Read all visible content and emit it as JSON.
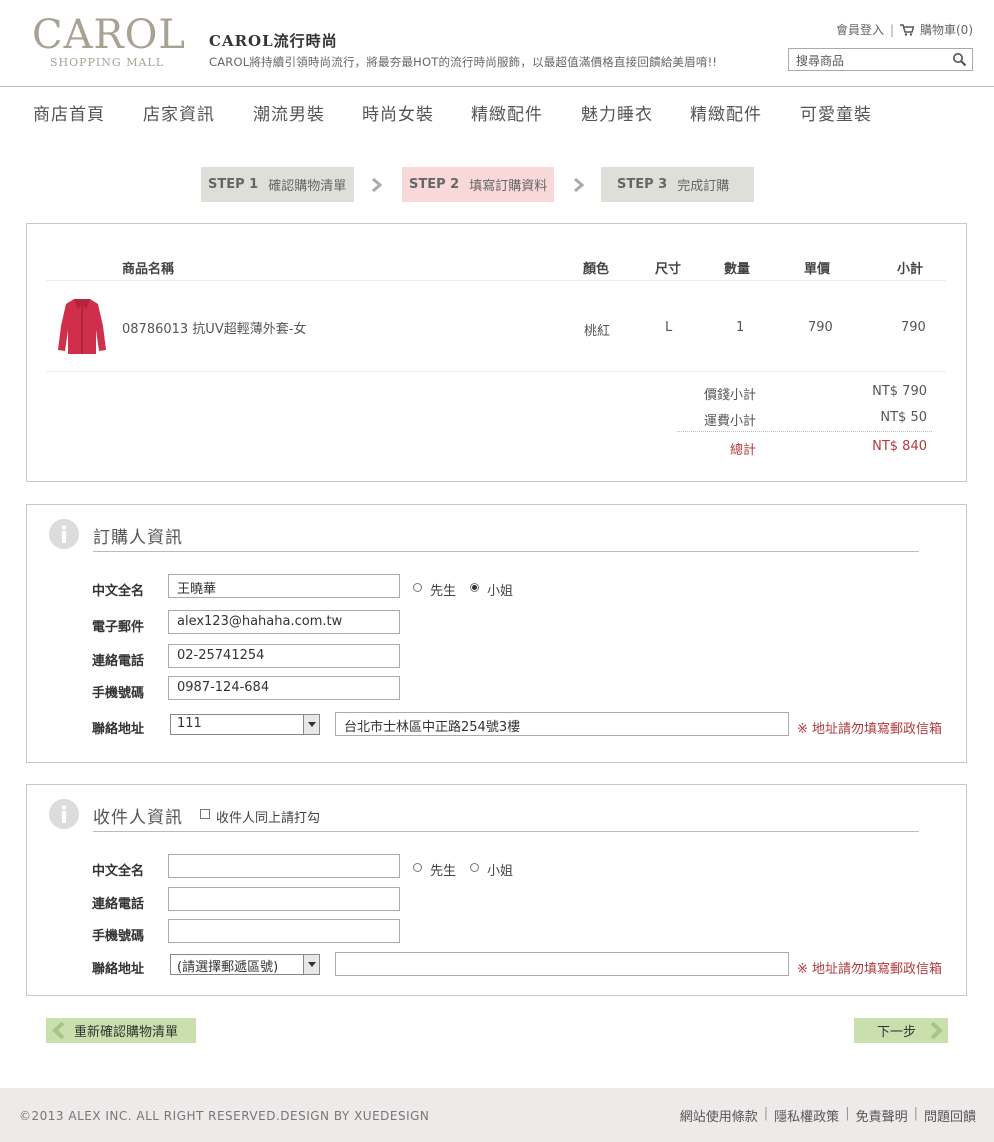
{
  "header": {
    "logo_main": "CAROL",
    "logo_sub": "SHOPPING MALL",
    "brand_title": "CAROL流行時尚",
    "slogan": "CAROL將持續引領時尚流行，將最夯最HOT的流行時尚服飾，以最超值滿價格直接回饋給美眉唷!!",
    "login_link": "會員登入",
    "cart_link": "購物車(0)",
    "search_placeholder": "搜尋商品"
  },
  "nav": [
    "商店首頁",
    "店家資訊",
    "潮流男裝",
    "時尚女裝",
    "精緻配件",
    "魅力睡衣",
    "精緻配件",
    "可愛童裝"
  ],
  "steps": [
    {
      "num": "STEP 1",
      "label": "確認購物清單",
      "bg": "#dedfd9"
    },
    {
      "num": "STEP 2",
      "label": "填寫訂購資料",
      "bg": "#f8d8d8"
    },
    {
      "num": "STEP 3",
      "label": "完成訂購",
      "bg": "#dedfd9"
    }
  ],
  "cart": {
    "headers": {
      "name": "商品名稱",
      "color": "顏色",
      "size": "尺寸",
      "qty": "數量",
      "price": "單價",
      "subtotal": "小計"
    },
    "items": [
      {
        "name": "08786013 抗UV超輕薄外套-女",
        "color": "桃紅",
        "size": "L",
        "qty": "1",
        "price": "790",
        "subtotal": "790"
      }
    ],
    "summary": {
      "goods_label": "價錢小計",
      "goods_value": "NT$ 790",
      "shipping_label": "運費小計",
      "shipping_value": "NT$ 50",
      "total_label": "總計",
      "total_value": "NT$ 840"
    }
  },
  "buyer": {
    "title": "訂購人資訊",
    "name_label": "中文全名",
    "name_value": "王曉華",
    "mr_label": "先生",
    "ms_label": "小姐",
    "email_label": "電子郵件",
    "email_value": "alex123@hahaha.com.tw",
    "phone_label": "連絡電話",
    "phone_value": "02-25741254",
    "mobile_label": "手機號碼",
    "mobile_value": "0987-124-684",
    "address_label": "聯絡地址",
    "zip_value": "111",
    "address_value": "台北市士林區中正路254號3樓",
    "note": "※ 地址請勿填寫郵政信箱"
  },
  "receiver": {
    "title": "收件人資訊",
    "same_label": "收件人同上請打勾",
    "name_label": "中文全名",
    "mr_label": "先生",
    "ms_label": "小姐",
    "phone_label": "連絡電話",
    "mobile_label": "手機號碼",
    "address_label": "聯絡地址",
    "zip_value": "(請選擇郵遞區號)",
    "note": "※ 地址請勿填寫郵政信箱"
  },
  "buttons": {
    "back": "重新確認購物清單",
    "next": "下一步"
  },
  "footer": {
    "copyright": "©2013 ALEX INC. ALL RIGHT RESERVED.DESIGN BY XUEDESIGN",
    "links": [
      "網站使用條款",
      "隱私權政策",
      "免責聲明",
      "問題回饋"
    ]
  }
}
